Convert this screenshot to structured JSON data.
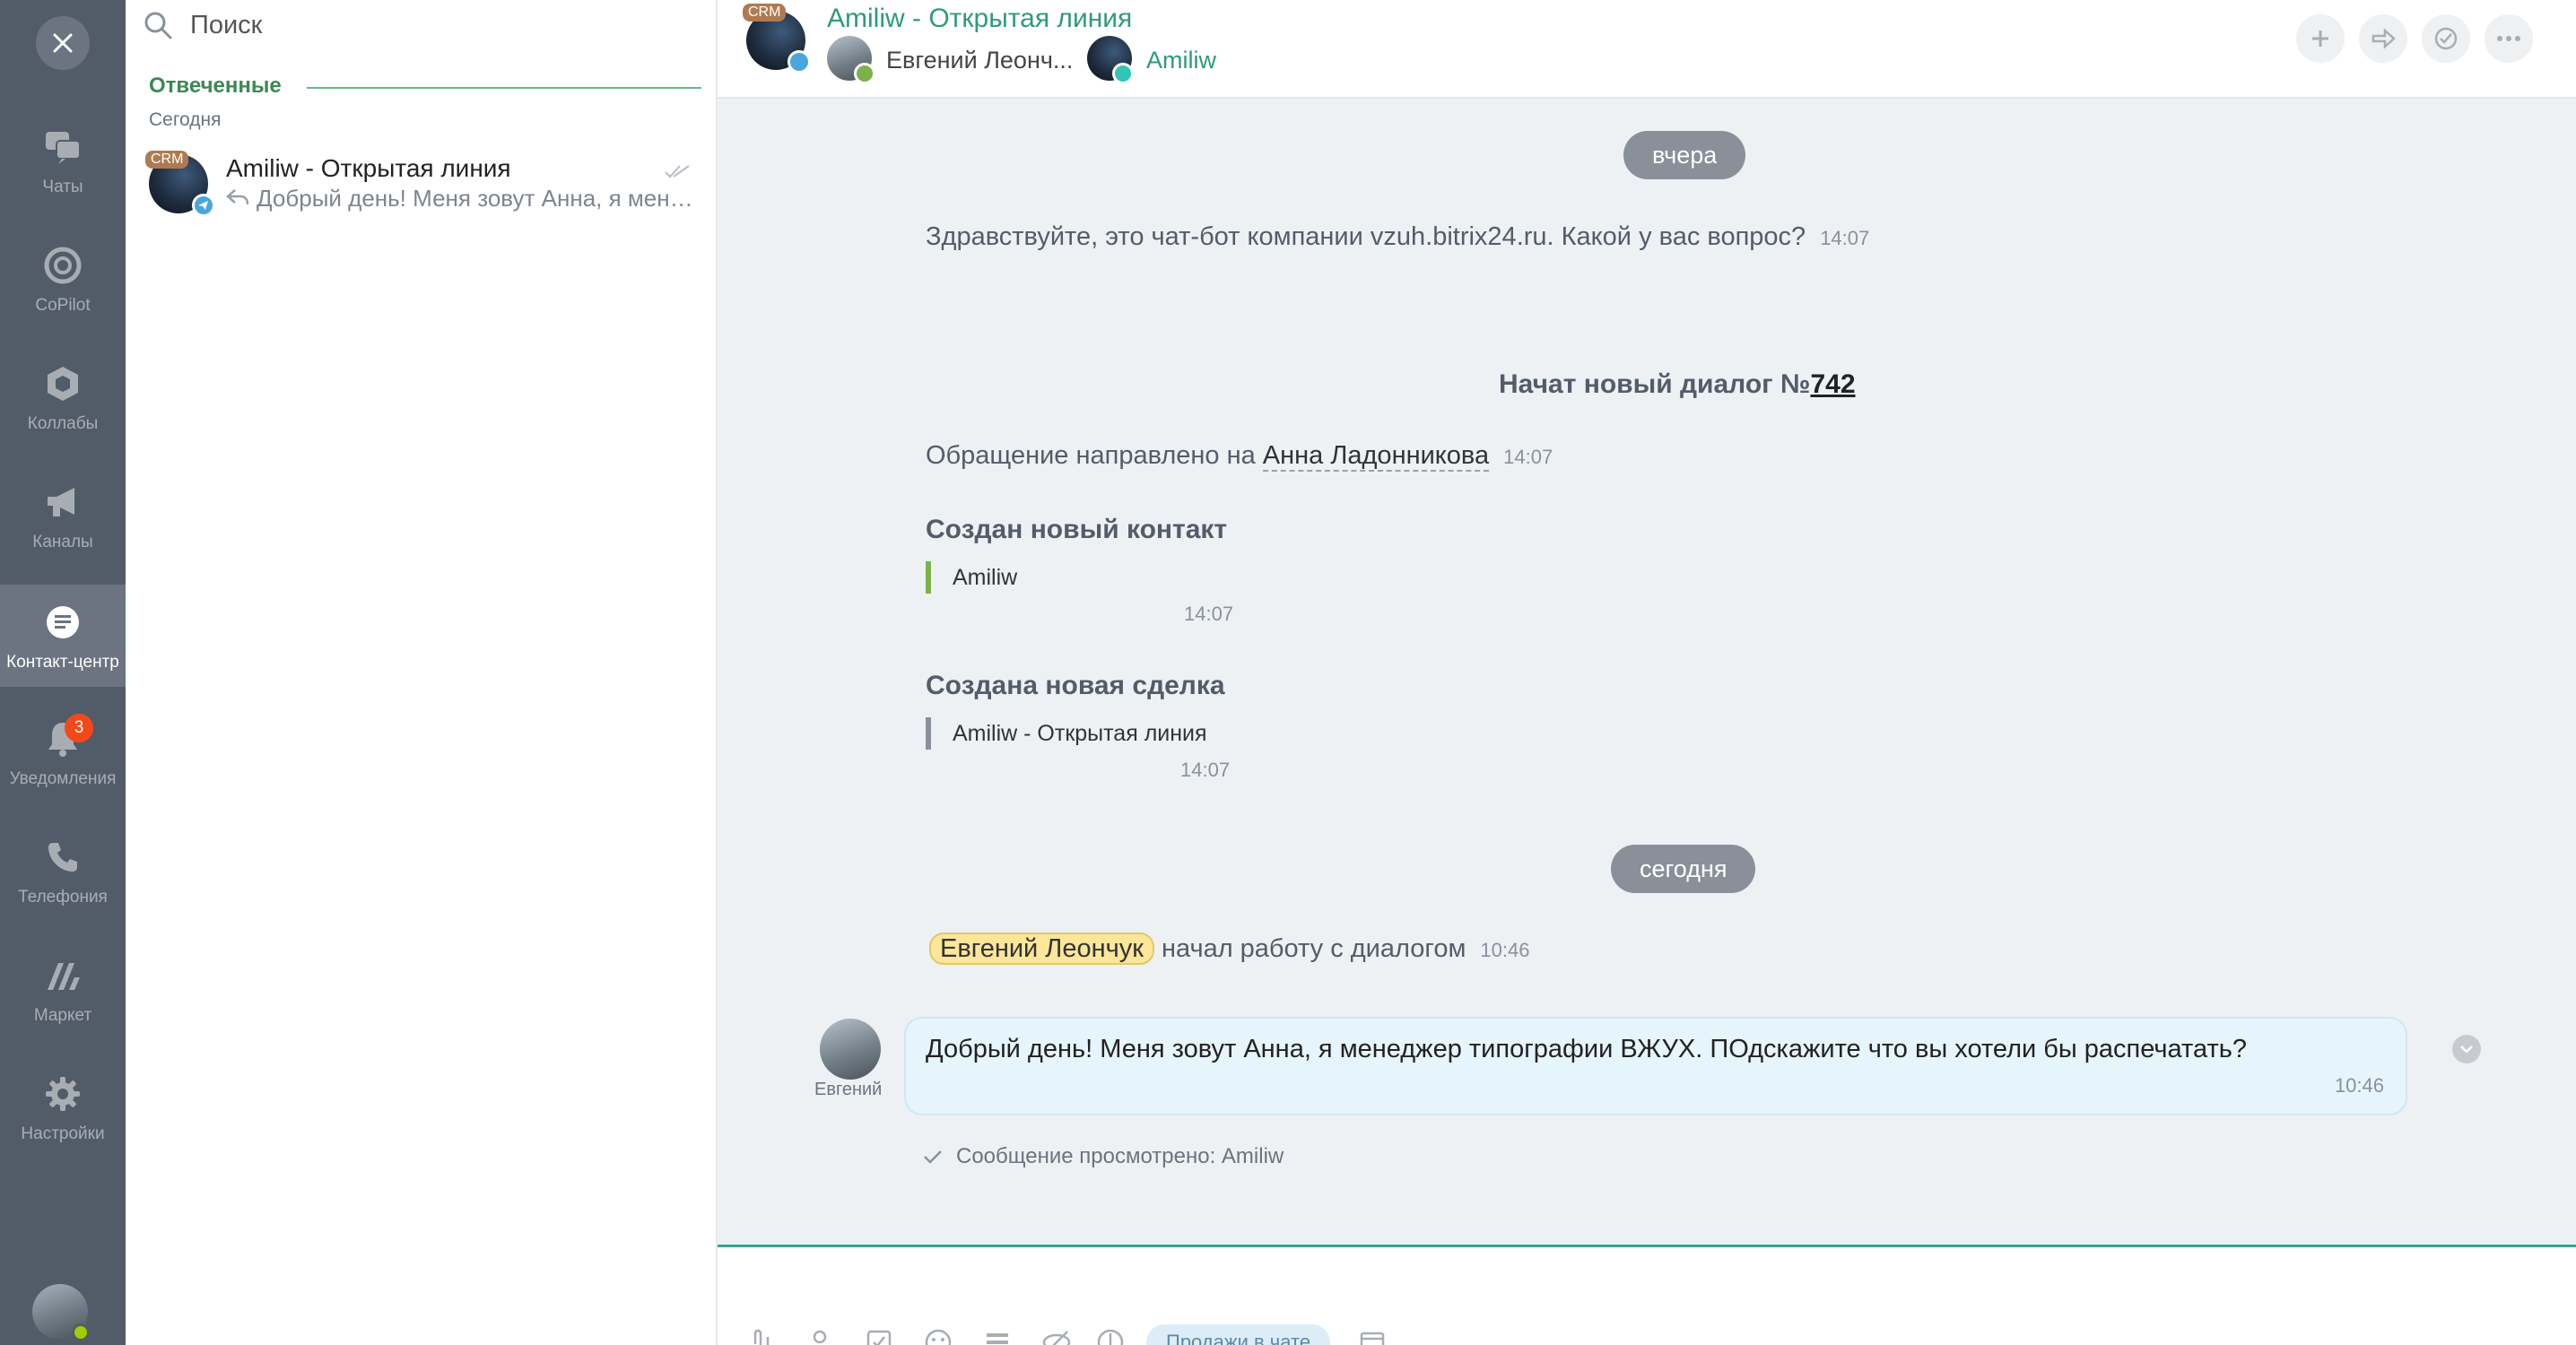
{
  "nav": {
    "items": [
      {
        "label": "Чаты",
        "icon": "chats-icon"
      },
      {
        "label": "CoPilot",
        "icon": "copilot-icon"
      },
      {
        "label": "Коллабы",
        "icon": "collabs-icon"
      },
      {
        "label": "Каналы",
        "icon": "megaphone-icon"
      },
      {
        "label": "Контакт-центр",
        "icon": "contact-center-icon"
      },
      {
        "label": "Уведомления",
        "icon": "bell-icon",
        "badge": "3"
      },
      {
        "label": "Телефония",
        "icon": "phone-icon"
      },
      {
        "label": "Маркет",
        "icon": "market-icon"
      },
      {
        "label": "Настройки",
        "icon": "gear-icon"
      }
    ],
    "active_index": 4
  },
  "list": {
    "search_placeholder": "Поиск",
    "group_title": "Отвеченные",
    "group_subtitle": "Сегодня",
    "items": [
      {
        "tag": "CRM",
        "title": "Amiliw - Открытая линия",
        "preview": "Добрый день! Меня зовут Анна, я менеджер типографии ВЖУХ."
      }
    ]
  },
  "header": {
    "tag": "CRM",
    "title": "Amiliw - Открытая линия",
    "user1": "Евгений Леонч...",
    "user2": "Amiliw"
  },
  "messages": {
    "date1": "вчера",
    "bot_greeting": "Здравствуйте, это чат-бот компании vzuh.bitrix24.ru. Какой у вас вопрос?",
    "bot_greeting_time": "14:07",
    "new_dialog_prefix": "Начат новый диалог №",
    "new_dialog_number": "742",
    "redirect_prefix": "Обращение направлено на",
    "redirect_name": "Анна Ладонникова",
    "redirect_time": "14:07",
    "contact_title": "Создан новый контакт",
    "contact_name": "Amiliw",
    "contact_time": "14:07",
    "deal_title": "Создана новая сделка",
    "deal_name": "Amiliw - Открытая линия",
    "deal_time": "14:07",
    "date2": "сегодня",
    "start_name": "Евгений Леончук",
    "start_text": "начал работу с диалогом",
    "start_time": "10:46",
    "author_short": "Евгений",
    "message_text": "Добрый день! Меня зовут Анна, я менеджер типографии ВЖУХ. ПОдскажите что вы хотели бы распечатать?",
    "message_time": "10:46",
    "seen_text": "Сообщение просмотрено: Amiliw"
  },
  "composer": {
    "sales_chip": "Продажи в чате"
  },
  "colors": {
    "nav_bg": "#525c69",
    "accent_green": "#2f9b78",
    "badge_red": "#f54819",
    "bubble_bg": "#e6f4fb"
  }
}
